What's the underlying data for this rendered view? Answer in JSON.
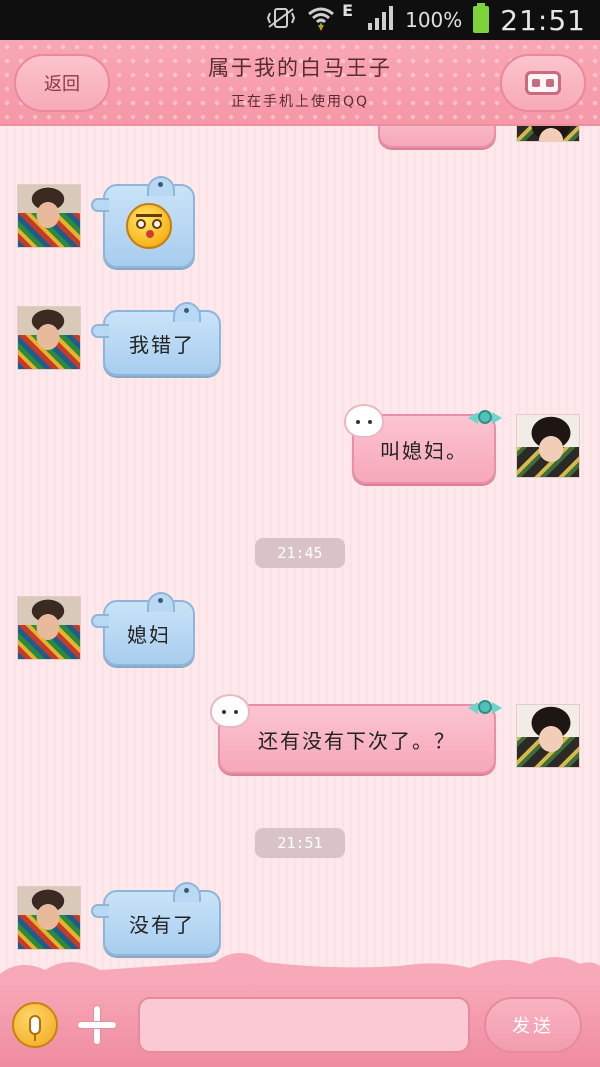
{
  "status_bar": {
    "network_type": "E",
    "battery_percent": "100%",
    "time": "21:51"
  },
  "header": {
    "back_label": "返回",
    "title": "属于我的白马王子",
    "subtitle": "正在手机上使用QQ"
  },
  "messages": [
    {
      "side": "left",
      "type": "emoji",
      "emoji": "shocked-face-icon"
    },
    {
      "side": "left",
      "type": "text",
      "text": "我错了"
    },
    {
      "side": "right",
      "type": "text",
      "text": "叫媳妇。"
    },
    {
      "side": "center",
      "type": "time",
      "text": "21:45"
    },
    {
      "side": "left",
      "type": "text",
      "text": "媳妇"
    },
    {
      "side": "right",
      "type": "text",
      "text": "还有没有下次了。？"
    },
    {
      "side": "center",
      "type": "time",
      "text": "21:51"
    },
    {
      "side": "left",
      "type": "text",
      "text": "没有了"
    }
  ],
  "input_bar": {
    "input_value": "",
    "send_label": "发送"
  },
  "colors": {
    "header_pink": "#f7a3b2",
    "bubble_blue": "#b9d8f3",
    "bubble_pink": "#f9b6c6",
    "time_pill": "#d9c3c6"
  }
}
